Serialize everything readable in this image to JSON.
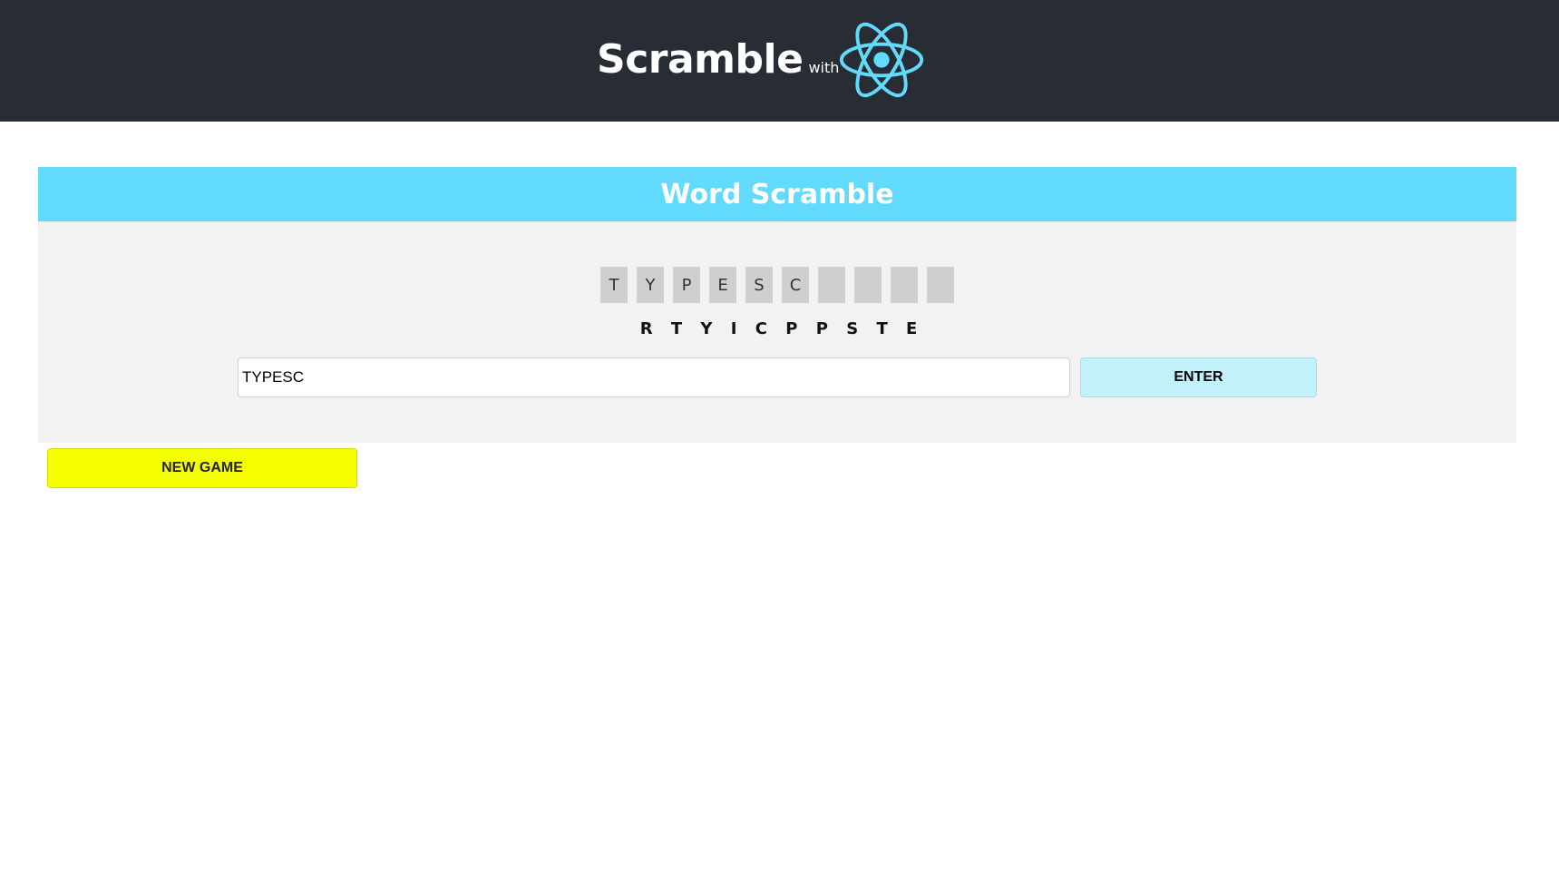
{
  "header": {
    "title": "Scramble",
    "subtitle": "with",
    "logo_icon": "react-atom-icon",
    "logo_color": "#61dafb",
    "background": "#282c35"
  },
  "game": {
    "title": "Word Scramble",
    "accent": "#61dafb",
    "slots": [
      "T",
      "Y",
      "P",
      "E",
      "S",
      "C",
      "",
      "",
      "",
      ""
    ],
    "scrambled_letters": [
      "R",
      "T",
      "Y",
      "I",
      "C",
      "P",
      "P",
      "S",
      "T",
      "E"
    ],
    "input": {
      "value": "TYPESC",
      "placeholder": ""
    },
    "enter_label": "ENTER",
    "new_game_label": "NEW GAME",
    "new_game_color": "#f5ff00"
  }
}
